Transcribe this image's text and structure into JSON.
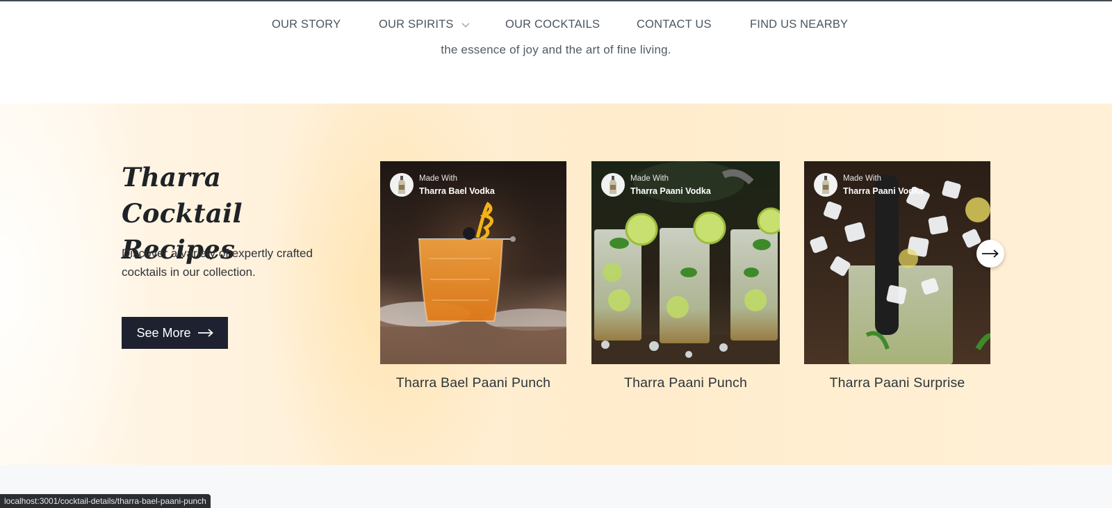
{
  "nav": {
    "items": [
      {
        "label": "OUR STORY"
      },
      {
        "label": "OUR SPIRITS",
        "icon": "chevron-down-icon"
      },
      {
        "label": "OUR COCKTAILS"
      },
      {
        "label": "CONTACT US"
      },
      {
        "label": "FIND US NEARBY"
      }
    ]
  },
  "tagline": "the essence of joy and the art of fine living.",
  "recipes": {
    "title": "Tharra Cocktail Recipes",
    "description": "Discover a variety of expertly crafted cocktails in our collection.",
    "see_more_label": "See More",
    "see_more_icon": "arrow-right-icon",
    "next_icon": "arrow-right-icon",
    "cards": [
      {
        "made_with_label": "Made With",
        "spirit": "Tharra Bael Vodka",
        "name": "Tharra Bael Paani Punch"
      },
      {
        "made_with_label": "Made With",
        "spirit": "Tharra Paani Vodka",
        "name": "Tharra Paani Punch"
      },
      {
        "made_with_label": "Made With",
        "spirit": "Tharra Paani Vodka",
        "name": "Tharra Paani Surprise"
      }
    ]
  },
  "status_bar": {
    "url": "localhost:3001/cocktail-details/tharra-bael-paani-punch"
  },
  "colors": {
    "button_bg": "#1d2130",
    "section_bg": "#ffeccc",
    "nav_text": "#4a5560"
  }
}
